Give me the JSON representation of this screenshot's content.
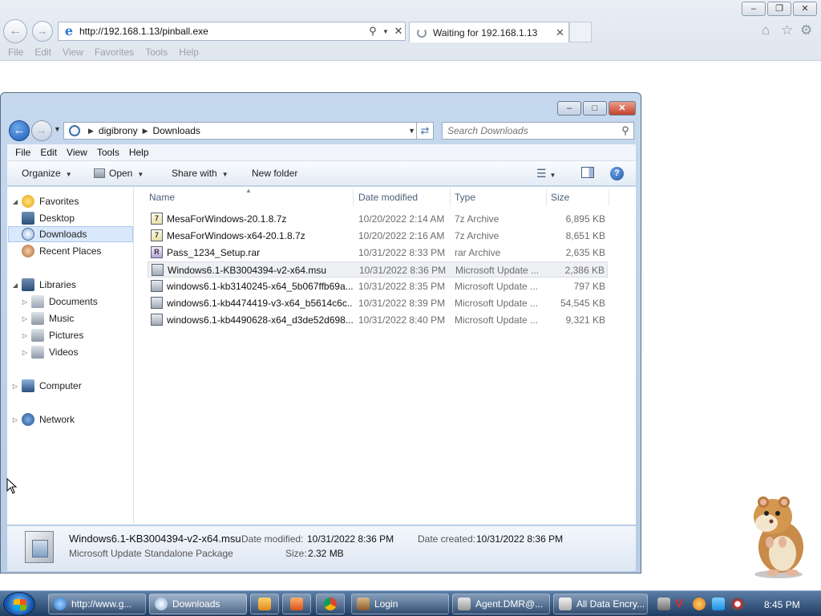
{
  "browser": {
    "url": "http://192.168.1.13/pinball.exe",
    "tab_title": "Waiting for 192.168.1.13",
    "menu": [
      "File",
      "Edit",
      "View",
      "Favorites",
      "Tools",
      "Help"
    ]
  },
  "explorer": {
    "breadcrumb": [
      "digibrony",
      "Downloads"
    ],
    "search_placeholder": "Search Downloads",
    "menu": [
      "File",
      "Edit",
      "View",
      "Tools",
      "Help"
    ],
    "toolbar": {
      "organize": "Organize",
      "open": "Open",
      "share_with": "Share with",
      "new_folder": "New folder"
    },
    "nav": {
      "favorites": "Favorites",
      "desktop": "Desktop",
      "downloads": "Downloads",
      "recent_places": "Recent Places",
      "libraries": "Libraries",
      "documents": "Documents",
      "music": "Music",
      "pictures": "Pictures",
      "videos": "Videos",
      "computer": "Computer",
      "network": "Network"
    },
    "columns": {
      "name": "Name",
      "date": "Date modified",
      "type": "Type",
      "size": "Size"
    },
    "files": [
      {
        "name": "MesaForWindows-20.1.8.7z",
        "date": "10/20/2022 2:14 AM",
        "type": "7z Archive",
        "size": "6,895 KB",
        "icon": "7z"
      },
      {
        "name": "MesaForWindows-x64-20.1.8.7z",
        "date": "10/20/2022 2:16 AM",
        "type": "7z Archive",
        "size": "8,651 KB",
        "icon": "7z"
      },
      {
        "name": "Pass_1234_Setup.rar",
        "date": "10/31/2022 8:33 PM",
        "type": "rar Archive",
        "size": "2,635 KB",
        "icon": "rar"
      },
      {
        "name": "Windows6.1-KB3004394-v2-x64.msu",
        "date": "10/31/2022 8:36 PM",
        "type": "Microsoft Update ...",
        "size": "2,386 KB",
        "icon": "msu"
      },
      {
        "name": "windows6.1-kb3140245-x64_5b067ffb69a...",
        "date": "10/31/2022 8:35 PM",
        "type": "Microsoft Update ...",
        "size": "797 KB",
        "icon": "msu"
      },
      {
        "name": "windows6.1-kb4474419-v3-x64_b5614c6c...",
        "date": "10/31/2022 8:39 PM",
        "type": "Microsoft Update ...",
        "size": "54,545 KB",
        "icon": "msu"
      },
      {
        "name": "windows6.1-kb4490628-x64_d3de52d698...",
        "date": "10/31/2022 8:40 PM",
        "type": "Microsoft Update ...",
        "size": "9,321 KB",
        "icon": "msu"
      }
    ],
    "selected_index": 3,
    "details": {
      "name": "Windows6.1-KB3004394-v2-x64.msu",
      "type": "Microsoft Update Standalone Package",
      "date_modified_label": "Date modified:",
      "date_modified": "10/31/2022 8:36 PM",
      "date_created_label": "Date created:",
      "date_created": "10/31/2022 8:36 PM",
      "size_label": "Size:",
      "size": "2.32 MB"
    }
  },
  "taskbar": {
    "buttons": [
      "http://www.g...",
      "Downloads",
      "Login",
      "Agent.DMR@...",
      "All Data Encry..."
    ],
    "clock": "8:45 PM"
  }
}
